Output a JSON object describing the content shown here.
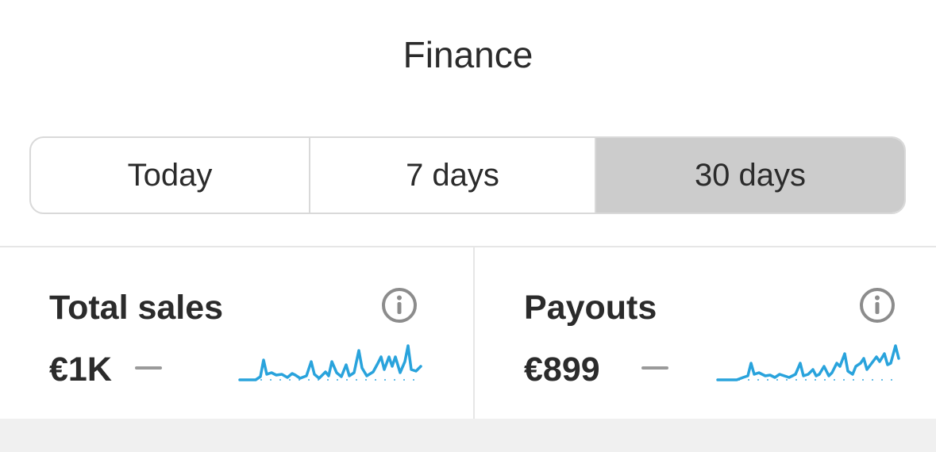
{
  "header": {
    "title": "Finance"
  },
  "range_selector": {
    "options": [
      "Today",
      "7 days",
      "30 days"
    ],
    "selected": "30 days"
  },
  "cards": [
    {
      "title": "Total sales",
      "value": "€1K",
      "info_icon": "info-icon",
      "trend_icon": "dash-icon"
    },
    {
      "title": "Payouts",
      "value": "€899",
      "info_icon": "info-icon",
      "trend_icon": "dash-icon"
    }
  ],
  "colors": {
    "sparkline": "#29a3dc",
    "selected_segment": "#cccccc",
    "border": "#d9d9d9",
    "text": "#2b2b2b"
  }
}
